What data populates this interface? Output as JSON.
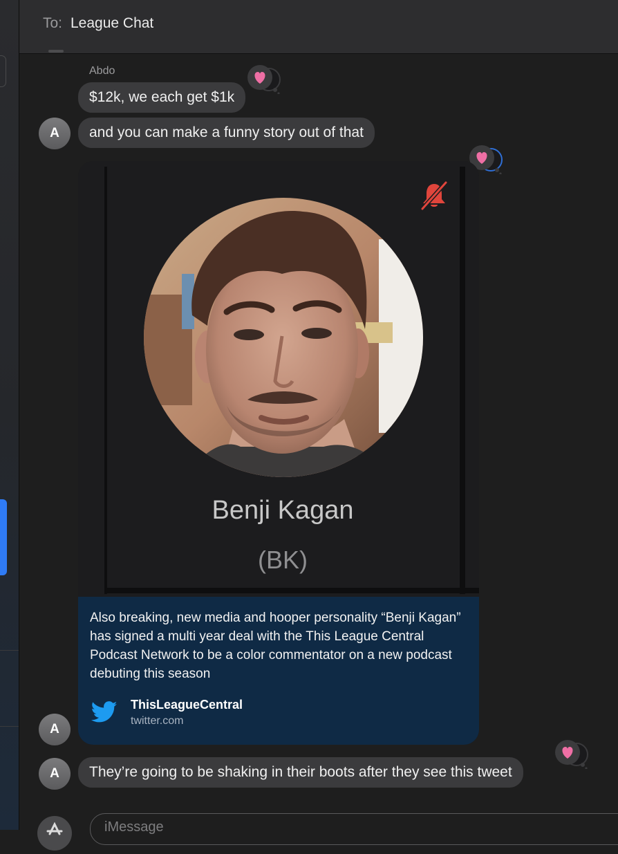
{
  "header": {
    "to_label": "To:",
    "recipient": "League Chat"
  },
  "messages": {
    "sender_name": "Abdo",
    "msg1": "$12k, we each get $1k",
    "msg2": "and you can make a funny story out of that",
    "msg3": "They’re going to be shaking in their boots after they see this tweet",
    "avatar_initial": "A"
  },
  "link_preview": {
    "profile_name": "Benji Kagan",
    "profile_handle": "(BK)",
    "description": "Also breaking, new media and hooper personality “Benji Kagan” has signed a multi year deal with the This League Central Podcast Network to be a color commentator on a new podcast debuting this season",
    "source_name": "ThisLeagueCentral",
    "source_domain": "twitter.com",
    "source_icon": "twitter-bird-icon",
    "muted_icon": "bell-slash-icon"
  },
  "composer": {
    "placeholder": "iMessage"
  },
  "colors": {
    "bubble_gray": "#3b3b3d",
    "card_body": "#0f2a45",
    "heart_pink": "#ef6fa5",
    "twitter_blue": "#1d9bf0",
    "sidebar_accent": "#2f7bf5",
    "mute_red": "#e0453c"
  }
}
